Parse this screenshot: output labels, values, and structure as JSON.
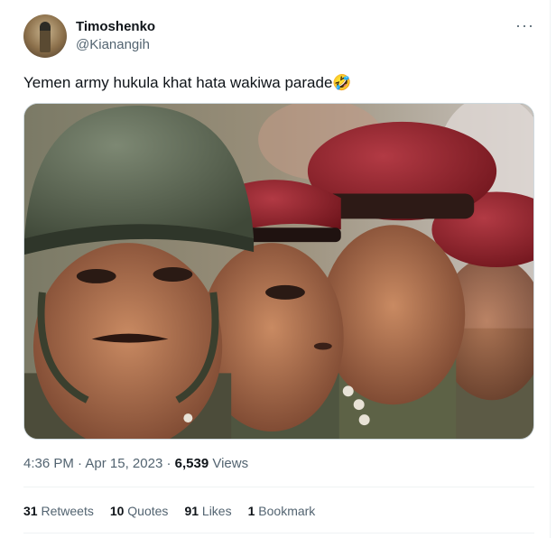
{
  "author": {
    "display_name": "Timoshenko",
    "handle": "@Kianangih",
    "avatar_icon": "profile-photo"
  },
  "more_icon": "more-options-icon",
  "tweet": {
    "text": "Yemen army hukula khat hata wakiwa parade",
    "emoji": "🤣",
    "media_icon": "photo-soldiers"
  },
  "meta": {
    "time": "4:36 PM",
    "date": "Apr 15, 2023",
    "separator": "·",
    "views_count": "6,539",
    "views_label": "Views"
  },
  "stats": {
    "retweets_count": "31",
    "retweets_label": "Retweets",
    "quotes_count": "10",
    "quotes_label": "Quotes",
    "likes_count": "91",
    "likes_label": "Likes",
    "bookmarks_count": "1",
    "bookmarks_label": "Bookmark"
  },
  "colors": {
    "text_primary": "#0f1419",
    "text_secondary": "#536471",
    "border": "#eff3f4",
    "beret_red": "#8e1b24",
    "helmet_green": "#5b6650"
  }
}
